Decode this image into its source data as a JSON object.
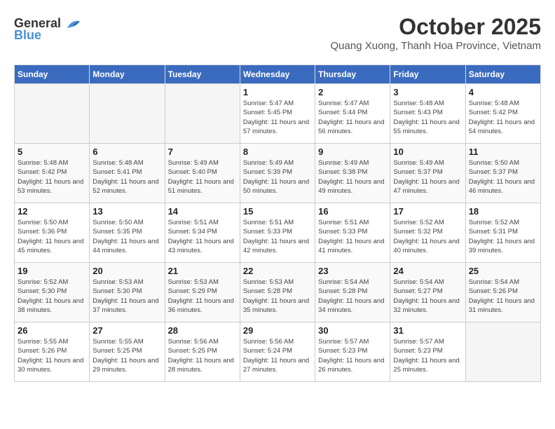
{
  "logo": {
    "line1": "General",
    "line2": "Blue"
  },
  "header": {
    "title": "October 2025",
    "subtitle": "Quang Xuong, Thanh Hoa Province, Vietnam"
  },
  "weekdays": [
    "Sunday",
    "Monday",
    "Tuesday",
    "Wednesday",
    "Thursday",
    "Friday",
    "Saturday"
  ],
  "weeks": [
    [
      {
        "day": "",
        "info": ""
      },
      {
        "day": "",
        "info": ""
      },
      {
        "day": "",
        "info": ""
      },
      {
        "day": "1",
        "info": "Sunrise: 5:47 AM\nSunset: 5:45 PM\nDaylight: 11 hours and 57 minutes."
      },
      {
        "day": "2",
        "info": "Sunrise: 5:47 AM\nSunset: 5:44 PM\nDaylight: 11 hours and 56 minutes."
      },
      {
        "day": "3",
        "info": "Sunrise: 5:48 AM\nSunset: 5:43 PM\nDaylight: 11 hours and 55 minutes."
      },
      {
        "day": "4",
        "info": "Sunrise: 5:48 AM\nSunset: 5:42 PM\nDaylight: 11 hours and 54 minutes."
      }
    ],
    [
      {
        "day": "5",
        "info": "Sunrise: 5:48 AM\nSunset: 5:42 PM\nDaylight: 11 hours and 53 minutes."
      },
      {
        "day": "6",
        "info": "Sunrise: 5:48 AM\nSunset: 5:41 PM\nDaylight: 11 hours and 52 minutes."
      },
      {
        "day": "7",
        "info": "Sunrise: 5:49 AM\nSunset: 5:40 PM\nDaylight: 11 hours and 51 minutes."
      },
      {
        "day": "8",
        "info": "Sunrise: 5:49 AM\nSunset: 5:39 PM\nDaylight: 11 hours and 50 minutes."
      },
      {
        "day": "9",
        "info": "Sunrise: 5:49 AM\nSunset: 5:38 PM\nDaylight: 11 hours and 49 minutes."
      },
      {
        "day": "10",
        "info": "Sunrise: 5:49 AM\nSunset: 5:37 PM\nDaylight: 11 hours and 47 minutes."
      },
      {
        "day": "11",
        "info": "Sunrise: 5:50 AM\nSunset: 5:37 PM\nDaylight: 11 hours and 46 minutes."
      }
    ],
    [
      {
        "day": "12",
        "info": "Sunrise: 5:50 AM\nSunset: 5:36 PM\nDaylight: 11 hours and 45 minutes."
      },
      {
        "day": "13",
        "info": "Sunrise: 5:50 AM\nSunset: 5:35 PM\nDaylight: 11 hours and 44 minutes."
      },
      {
        "day": "14",
        "info": "Sunrise: 5:51 AM\nSunset: 5:34 PM\nDaylight: 11 hours and 43 minutes."
      },
      {
        "day": "15",
        "info": "Sunrise: 5:51 AM\nSunset: 5:33 PM\nDaylight: 11 hours and 42 minutes."
      },
      {
        "day": "16",
        "info": "Sunrise: 5:51 AM\nSunset: 5:33 PM\nDaylight: 11 hours and 41 minutes."
      },
      {
        "day": "17",
        "info": "Sunrise: 5:52 AM\nSunset: 5:32 PM\nDaylight: 11 hours and 40 minutes."
      },
      {
        "day": "18",
        "info": "Sunrise: 5:52 AM\nSunset: 5:31 PM\nDaylight: 11 hours and 39 minutes."
      }
    ],
    [
      {
        "day": "19",
        "info": "Sunrise: 5:52 AM\nSunset: 5:30 PM\nDaylight: 11 hours and 38 minutes."
      },
      {
        "day": "20",
        "info": "Sunrise: 5:53 AM\nSunset: 5:30 PM\nDaylight: 11 hours and 37 minutes."
      },
      {
        "day": "21",
        "info": "Sunrise: 5:53 AM\nSunset: 5:29 PM\nDaylight: 11 hours and 36 minutes."
      },
      {
        "day": "22",
        "info": "Sunrise: 5:53 AM\nSunset: 5:28 PM\nDaylight: 11 hours and 35 minutes."
      },
      {
        "day": "23",
        "info": "Sunrise: 5:54 AM\nSunset: 5:28 PM\nDaylight: 11 hours and 34 minutes."
      },
      {
        "day": "24",
        "info": "Sunrise: 5:54 AM\nSunset: 5:27 PM\nDaylight: 11 hours and 32 minutes."
      },
      {
        "day": "25",
        "info": "Sunrise: 5:54 AM\nSunset: 5:26 PM\nDaylight: 11 hours and 31 minutes."
      }
    ],
    [
      {
        "day": "26",
        "info": "Sunrise: 5:55 AM\nSunset: 5:26 PM\nDaylight: 11 hours and 30 minutes."
      },
      {
        "day": "27",
        "info": "Sunrise: 5:55 AM\nSunset: 5:25 PM\nDaylight: 11 hours and 29 minutes."
      },
      {
        "day": "28",
        "info": "Sunrise: 5:56 AM\nSunset: 5:25 PM\nDaylight: 11 hours and 28 minutes."
      },
      {
        "day": "29",
        "info": "Sunrise: 5:56 AM\nSunset: 5:24 PM\nDaylight: 11 hours and 27 minutes."
      },
      {
        "day": "30",
        "info": "Sunrise: 5:57 AM\nSunset: 5:23 PM\nDaylight: 11 hours and 26 minutes."
      },
      {
        "day": "31",
        "info": "Sunrise: 5:57 AM\nSunset: 5:23 PM\nDaylight: 11 hours and 25 minutes."
      },
      {
        "day": "",
        "info": ""
      }
    ]
  ]
}
